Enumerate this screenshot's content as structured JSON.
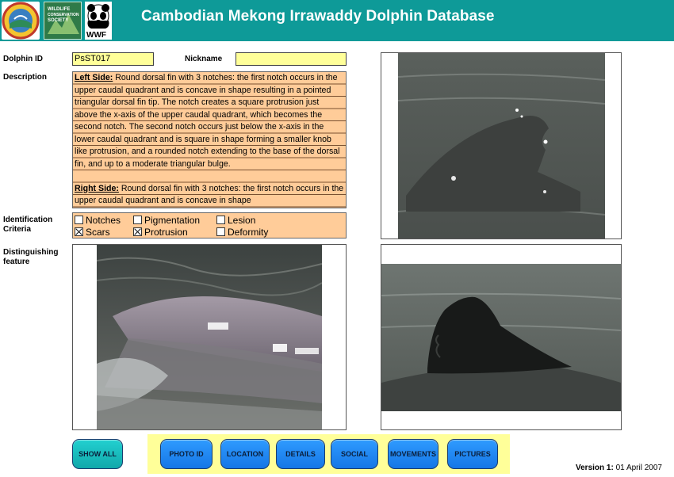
{
  "header": {
    "title": "Cambodian Mekong Irrawaddy Dolphin Database",
    "logos": {
      "wcs_text": "WILDLIFE CONSERVATION SOCIETY",
      "wwf_text": "WWF"
    }
  },
  "form": {
    "dolphin_id_label": "Dolphin ID",
    "dolphin_id_value": "PsST017",
    "nickname_label": "Nickname",
    "nickname_value": "",
    "description_label": "Description",
    "description": {
      "left_heading": "Left Side:",
      "left_text": "Round dorsal fin with 3 notches: the first notch occurs in the upper caudal quadrant and is concave in shape resulting in a pointed triangular dorsal fin tip. The notch creates a square protrusion just above the x-axis of the upper caudal quadrant, which becomes the second notch. The second notch occurs just below the x-axis in the lower caudal quadrant and is square in shape forming a smaller knob like protrusion, and a rounded notch extending to the base of the dorsal fin, and up to a moderate triangular bulge.",
      "right_heading": "Right Side:",
      "right_text": "Round dorsal fin with 3 notches: the first notch occurs in the upper caudal quadrant and is concave in shape"
    },
    "criteria_label_line1": "Identification",
    "criteria_label_line2": "Criteria",
    "criteria": [
      {
        "label": "Notches",
        "checked": false
      },
      {
        "label": "Pigmentation",
        "checked": false
      },
      {
        "label": "Lesion",
        "checked": false
      },
      {
        "label": "Scars",
        "checked": true
      },
      {
        "label": "Protrusion",
        "checked": true
      },
      {
        "label": "Deformity",
        "checked": false
      }
    ],
    "feature_label_line1": "Distinguishing",
    "feature_label_line2": "feature"
  },
  "buttons": {
    "show_all": "SHOW ALL",
    "photo_id": "PHOTO ID",
    "location": "LOCATION",
    "details": "DETAILS",
    "social": "SOCIAL",
    "movements": "MOVEMENTS",
    "pictures": "PICTURES"
  },
  "footer": {
    "version_label": "Version 1:",
    "version_date": "01 April 2007"
  },
  "colors": {
    "header_bg": "#0e9a98",
    "field_yellow": "#ffff99",
    "description_bg": "#ffcc99",
    "button_teal": "#11a8aa",
    "button_blue": "#1577e6"
  }
}
